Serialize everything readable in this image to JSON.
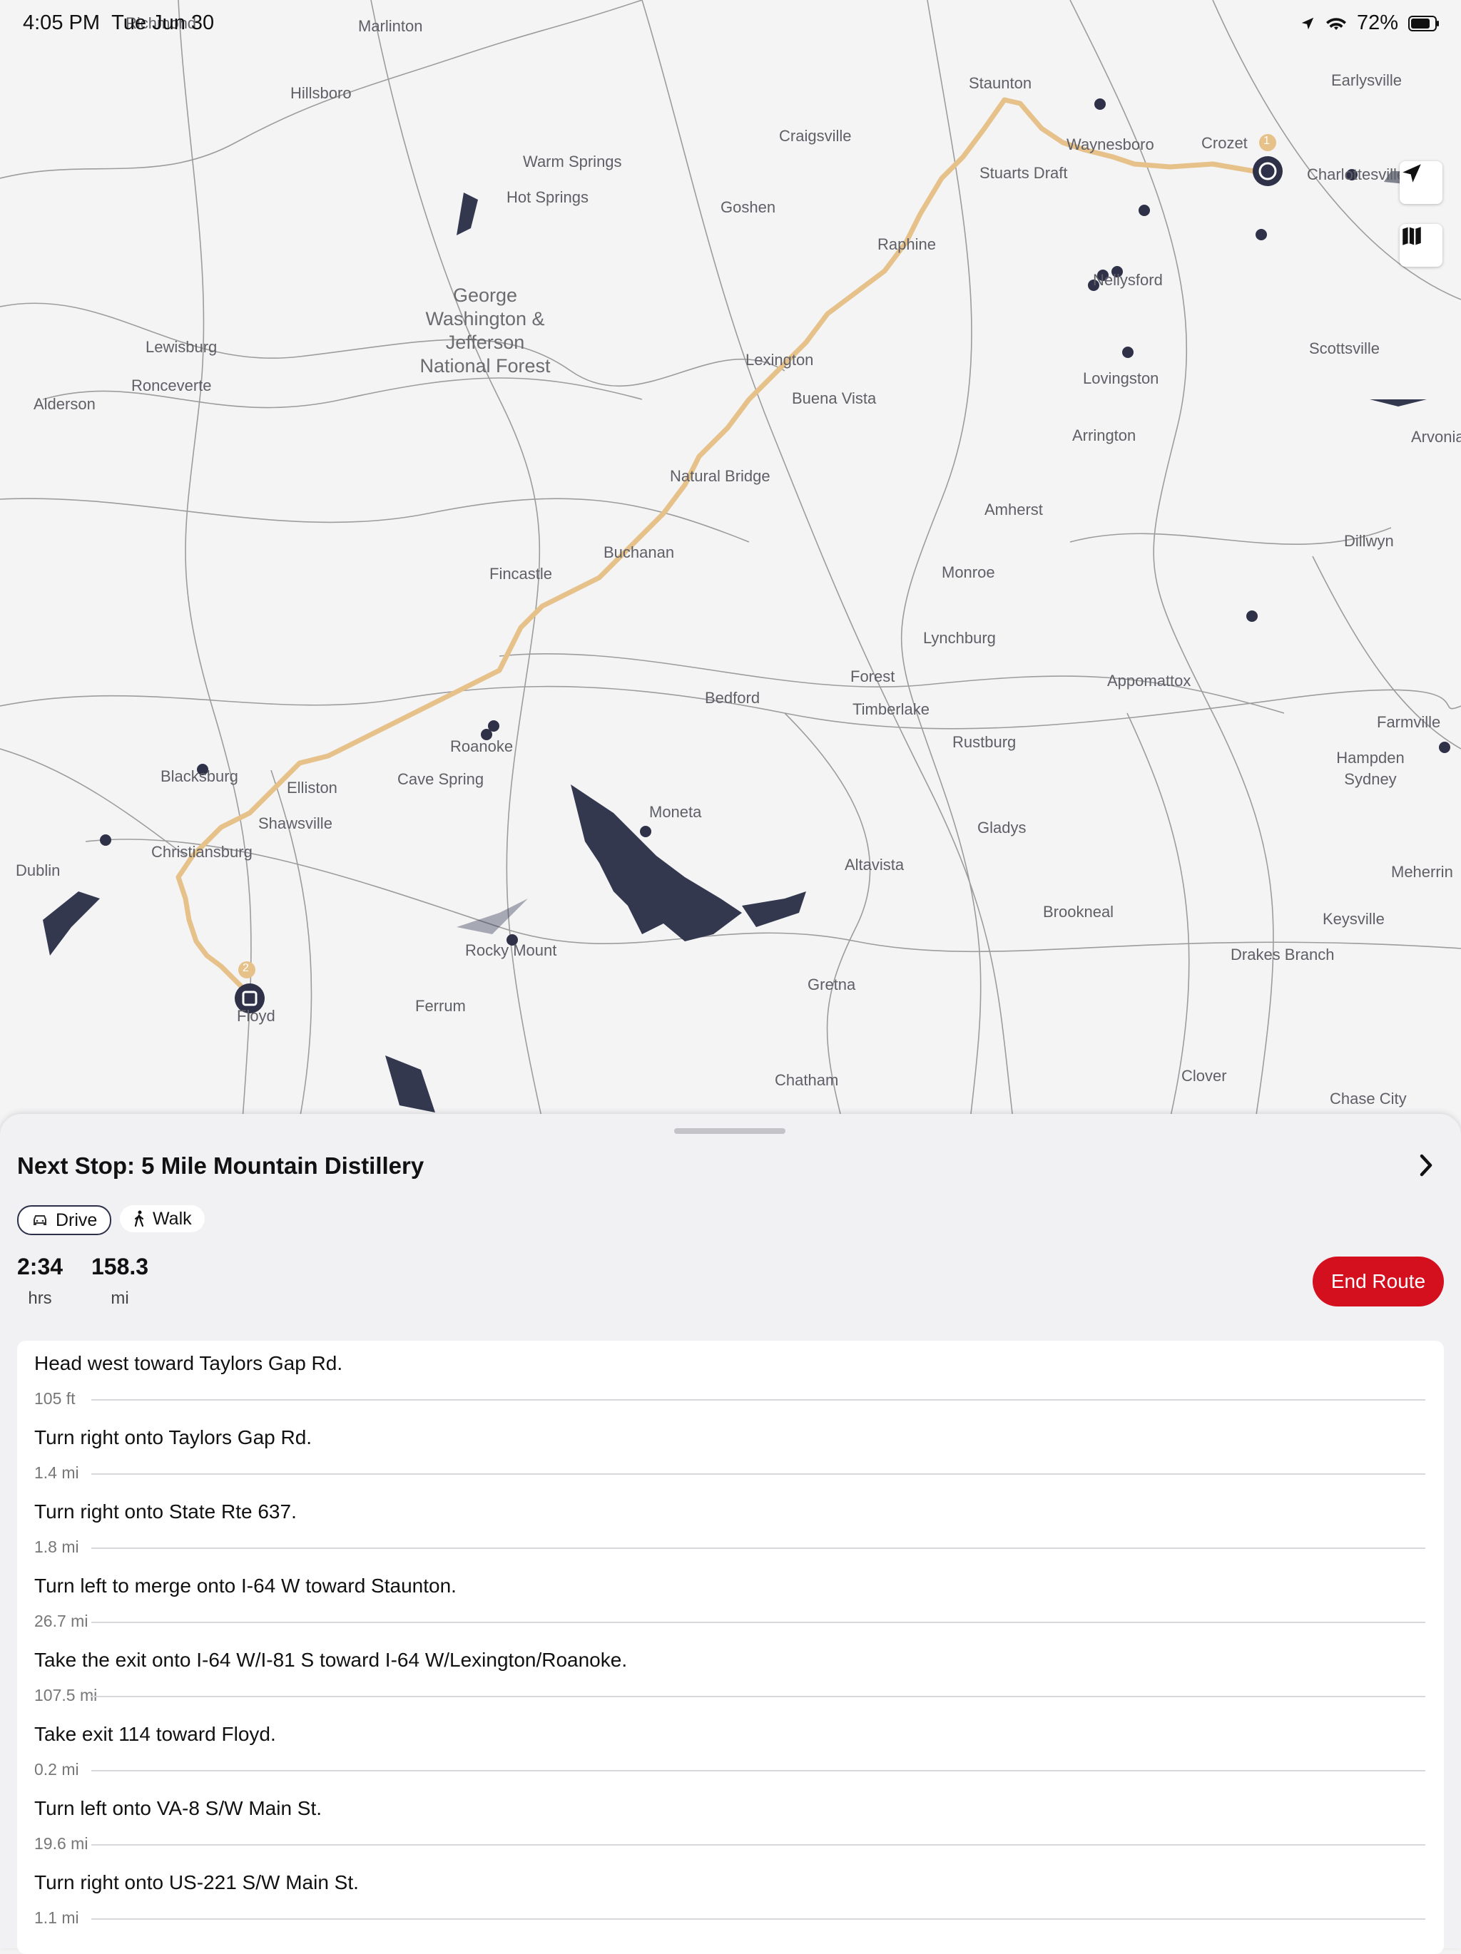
{
  "status": {
    "time": "4:05 PM",
    "date": "Tue Jun 30",
    "battery": "72%"
  },
  "map": {
    "labels": {
      "richmond": "Richmond",
      "marlinton": "Marlinton",
      "hillsboro": "Hillsboro",
      "staunton": "Staunton",
      "earlysville": "Earlysville",
      "craigsville": "Craigsville",
      "warm_springs": "Warm Springs",
      "hot_springs": "Hot Springs",
      "waynesboro": "Waynesboro",
      "crozet": "Crozet",
      "charlottesville": "Charlottesville",
      "stuarts_draft": "Stuarts Draft",
      "goshen": "Goshen",
      "raphine": "Raphine",
      "nellysford": "Nellysford",
      "forest_name": "George Washington & Jefferson National Forest",
      "lewisburg": "Lewisburg",
      "ronceverte": "Ronceverte",
      "alderson": "Alderson",
      "lexington": "Lexington",
      "buena_vista": "Buena Vista",
      "scottsville": "Scottsville",
      "lovingston": "Lovingston",
      "arrington": "Arrington",
      "arvonia": "Arvonia",
      "natural_bridge": "Natural Bridge",
      "amherst": "Amherst",
      "buchanan": "Buchanan",
      "fincastle": "Fincastle",
      "dillwyn": "Dillwyn",
      "monroe": "Monroe",
      "lynchburg": "Lynchburg",
      "forest": "Forest",
      "appomattox": "Appomattox",
      "bedford": "Bedford",
      "timberlake": "Timberlake",
      "farmville": "Farmville",
      "roanoke": "Roanoke",
      "rustburg": "Rustburg",
      "blacksburg": "Blacksburg",
      "elliston": "Elliston",
      "cave_spring": "Cave Spring",
      "hampden_sydney": "Hampden Sydney",
      "moneta": "Moneta",
      "shawsville": "Shawsville",
      "christiansburg": "Christiansburg",
      "gladys": "Gladys",
      "dublin": "Dublin",
      "altavista": "Altavista",
      "meherrin": "Meherrin",
      "brookneal": "Brookneal",
      "keysville": "Keysville",
      "rocky_mount": "Rocky Mount",
      "drakes_branch": "Drakes Branch",
      "floyd": "Floyd",
      "ferrum": "Ferrum",
      "gretna": "Gretna",
      "chatham": "Chatham",
      "clover": "Clover",
      "chase_city": "Chase City"
    },
    "stop_badges": {
      "first": "1",
      "second": "2"
    },
    "route_color": "#e6c28a",
    "marker_color": "#2e3148"
  },
  "sheet": {
    "title": "Next Stop: 5 Mile Mountain Distillery",
    "modes": {
      "drive": "Drive",
      "walk": "Walk"
    },
    "duration": {
      "value": "2:34",
      "unit": "hrs"
    },
    "distance": {
      "value": "158.3",
      "unit": "mi"
    },
    "end_route": "End Route",
    "accent": "#d4101f",
    "steps": [
      {
        "text": "Head west toward Taylors Gap Rd.",
        "distance": "105 ft"
      },
      {
        "text": "Turn right onto Taylors Gap Rd.",
        "distance": "1.4 mi"
      },
      {
        "text": "Turn right onto State Rte 637.",
        "distance": "1.8 mi"
      },
      {
        "text": "Turn left to merge onto I-64 W toward Staunton.",
        "distance": "26.7 mi"
      },
      {
        "text": "Take the exit onto I-64 W/I-81 S toward I-64 W/Lexington/Roanoke.",
        "distance": "107.5 mi"
      },
      {
        "text": "Take exit 114 toward Floyd.",
        "distance": "0.2 mi"
      },
      {
        "text": "Turn left onto VA-8 S/W Main St.",
        "distance": "19.6 mi"
      },
      {
        "text": "Turn right onto US-221 S/W Main St.",
        "distance": "1.1 mi"
      }
    ]
  }
}
